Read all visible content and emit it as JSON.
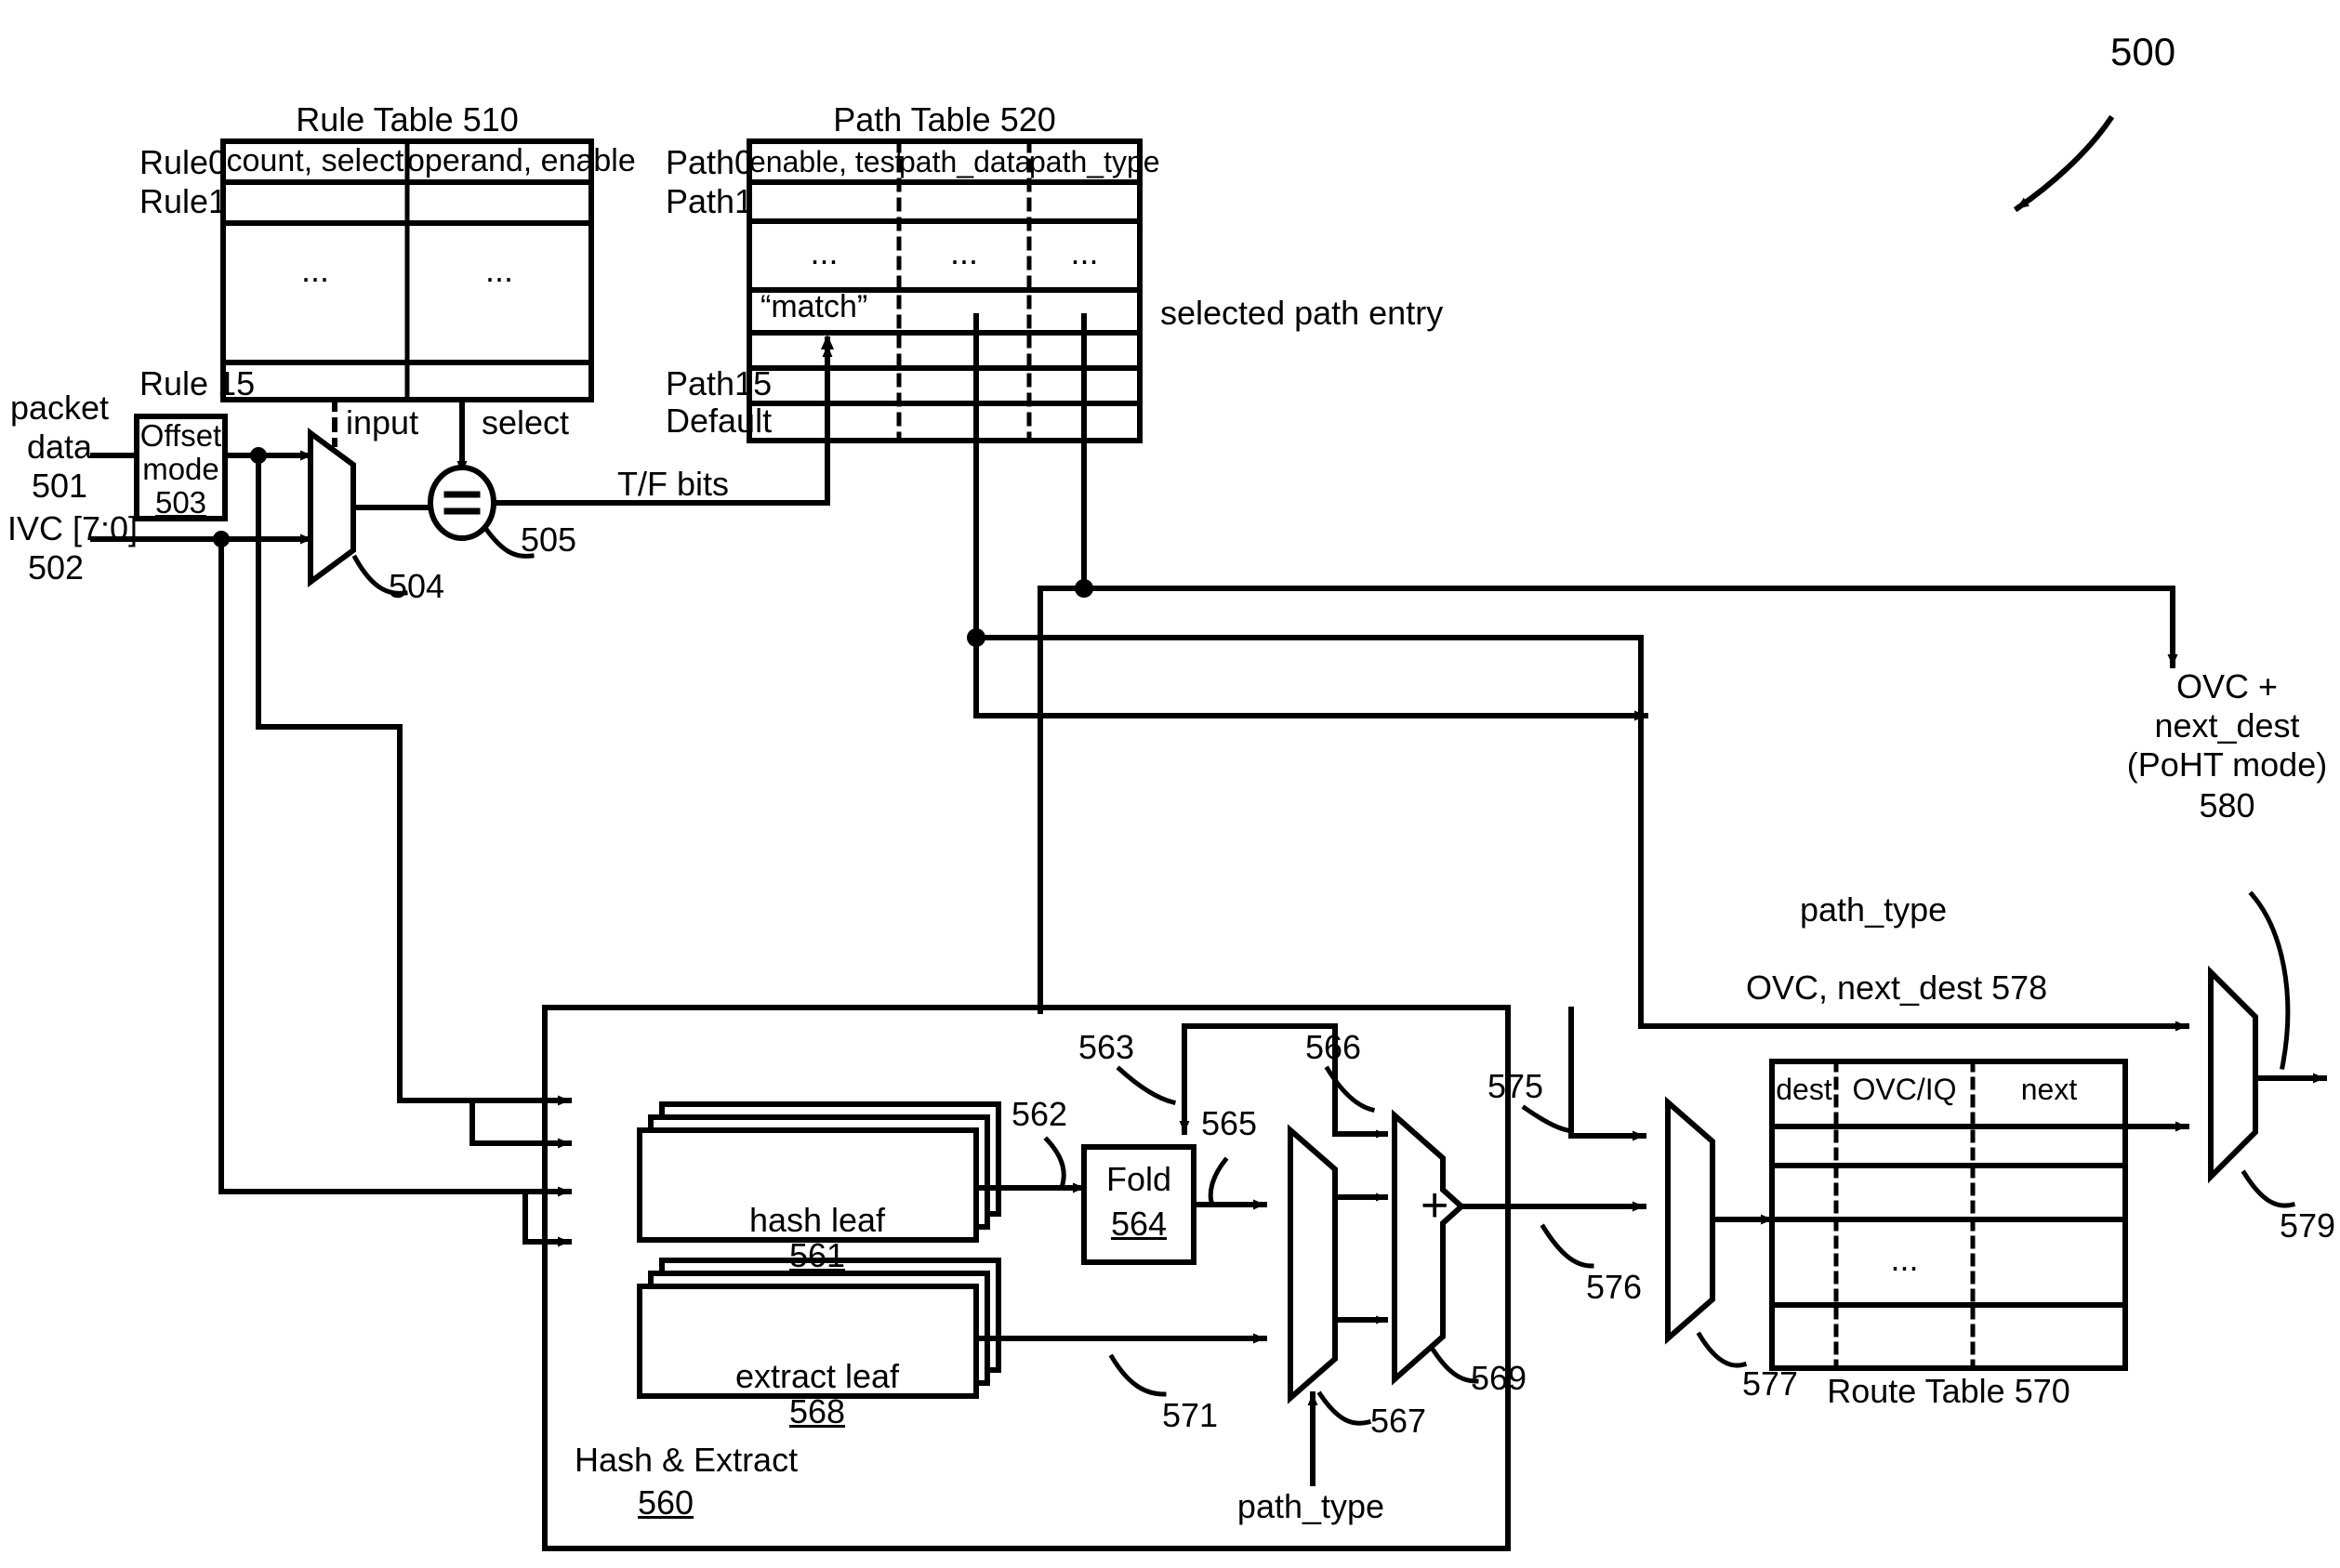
{
  "figure": {
    "number": "500",
    "ref_arrow": "curved-arrow-to-diagram"
  },
  "rule_table": {
    "title": "Rule Table 510",
    "columns": [
      "count, select",
      "operand, enable"
    ],
    "row_labels": [
      "Rule0",
      "Rule1",
      "Rule 15"
    ],
    "ellipsis": "...",
    "signals": {
      "input": "input",
      "select": "select"
    }
  },
  "path_table": {
    "title": "Path Table 520",
    "columns": [
      "enable, test",
      "path_data",
      "path_type"
    ],
    "row_labels": [
      "Path0",
      "Path1",
      "Path15",
      "Default"
    ],
    "ellipsis": "...",
    "match_cell": "“match”",
    "annotation": "selected path entry"
  },
  "inputs": {
    "packet_data": {
      "line1": "packet",
      "line2": "data",
      "ref": "501"
    },
    "ivc": {
      "line1": "IVC [7:0]",
      "ref": "502"
    }
  },
  "blocks": {
    "offset_mode": {
      "line1": "Offset",
      "line2": "mode",
      "ref": "503"
    },
    "hash_leaf": {
      "label": "hash leaf",
      "ref": "561"
    },
    "extract_leaf": {
      "label": "extract leaf",
      "ref": "568"
    },
    "fold": {
      "label": "Fold",
      "ref": "564"
    },
    "hash_extract": {
      "line1": "Hash & Extract",
      "ref": "560"
    },
    "route_table": {
      "title": "Route Table 570",
      "columns": [
        "dest",
        "OVC/IQ",
        "next"
      ],
      "ellipsis": "..."
    }
  },
  "refs": {
    "mux_504": "504",
    "comparator_505": "505",
    "bus_562": "562",
    "bus_563": "563",
    "bus_565": "565",
    "bus_566": "566",
    "mux_567": "567",
    "adder_569": "569",
    "bus_571": "571",
    "bus_575": "575",
    "bus_576": "576",
    "mux_577": "577",
    "mux_579": "579"
  },
  "signals": {
    "tf_bits": "T/F bits",
    "path_type_top": "path_type",
    "path_type_bottom": "path_type",
    "ovc_next_dest_578": "OVC, next_dest 578",
    "output": {
      "line1": "OVC +",
      "line2": "next_dest",
      "line3": "(PoHT mode)",
      "ref": "580"
    }
  },
  "glyphs": {
    "equals": "=",
    "plus": "+"
  },
  "colors": {
    "ink": "#000000",
    "paper": "#ffffff"
  }
}
